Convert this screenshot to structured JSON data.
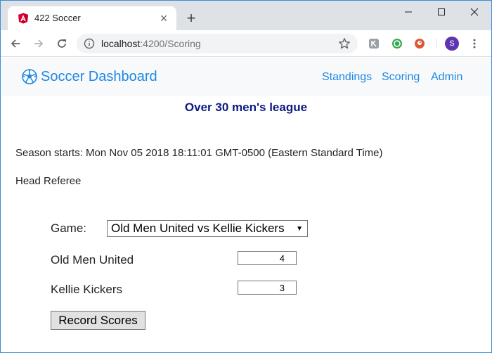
{
  "browser": {
    "tab": {
      "title": "422 Soccer",
      "favicon": "angular-icon"
    },
    "url": {
      "host": "localhost",
      "path": ":4200/Scoring"
    },
    "profile_initial": "S"
  },
  "navbar": {
    "brand": "Soccer Dashboard",
    "links": [
      "Standings",
      "Scoring",
      "Admin"
    ]
  },
  "main": {
    "league_title": "Over 30 men's league",
    "season_starts": "Season starts: Mon Nov 05 2018 18:11:01 GMT-0500 (Eastern Standard Time)",
    "referee_label": "Head Referee",
    "form": {
      "game_label": "Game:",
      "game_selected": "Old Men United vs Kellie Kickers",
      "home_team": "Old Men United",
      "home_score": "4",
      "away_team": "Kellie Kickers",
      "away_score": "3",
      "submit_label": "Record Scores"
    }
  },
  "colors": {
    "link": "#1e88e5",
    "league_title": "#0b1a80",
    "navbar_bg": "#f8f9fa",
    "tabstrip_bg": "#dee1e6"
  }
}
